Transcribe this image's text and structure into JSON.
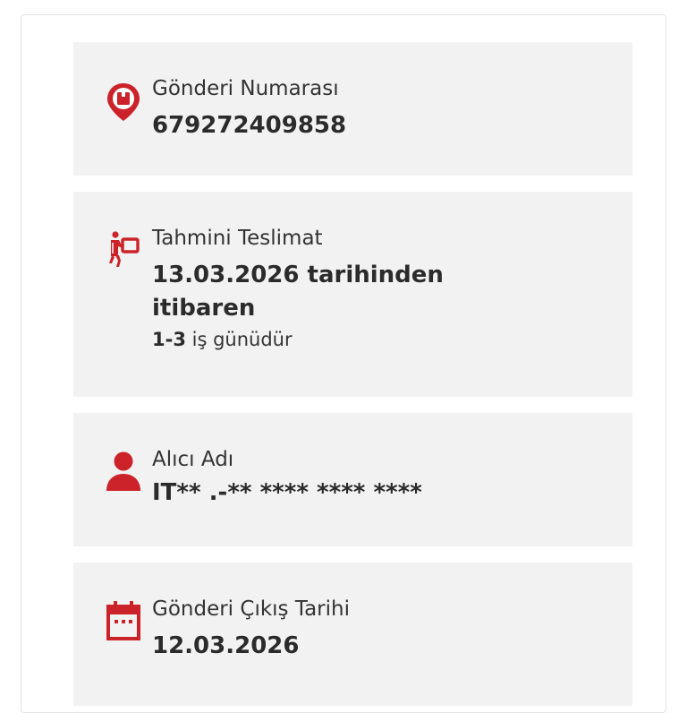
{
  "colors": {
    "accent": "#cc2229",
    "card_bg": "#f2f2f2",
    "text": "#333333"
  },
  "cards": [
    {
      "icon": "package-pin-icon",
      "label": "Gönderi Numarası",
      "value": "679272409858"
    },
    {
      "icon": "courier-icon",
      "label": "Tahmini Teslimat",
      "value_line1": "13.03.2026 tarihinden",
      "value_line2": "itibaren",
      "sub_bold": "1-3",
      "sub_text": " iş günüdür"
    },
    {
      "icon": "person-icon",
      "label": "Alıcı Adı",
      "value": "IT** .-** **** **** ****"
    },
    {
      "icon": "calendar-icon",
      "label": "Gönderi Çıkış Tarihi",
      "value": "12.03.2026"
    }
  ]
}
